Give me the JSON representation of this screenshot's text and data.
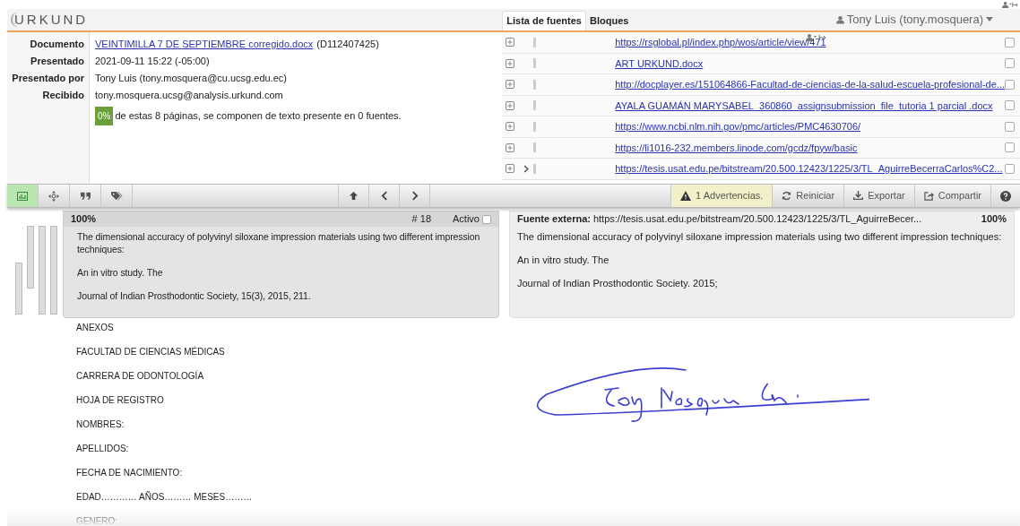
{
  "logo": "URKUND",
  "document_info": [
    {
      "label": "Documento",
      "link": "VEINTIMILLA 7 DE SEPTIEMBRE corregido.docx",
      "note": "(D112407425)"
    },
    {
      "label": "Presentado",
      "value": "2021-09-11 15:22 (-05:00)"
    },
    {
      "label": "Presentado por",
      "value": "Tony Luis (tony.mosquera@cu.ucsg.edu.ec)"
    },
    {
      "label": "Recibido",
      "value": "tony.mosquera.ucsg@analysis.urkund.com"
    }
  ],
  "similarity": {
    "percent": "0%",
    "text": "de estas 8 páginas, se componen de texto presente en 0 fuentes."
  },
  "tabs": [
    {
      "label": "Lista de fuentes",
      "selected": true
    },
    {
      "label": "Bloques",
      "selected": false
    }
  ],
  "user_menu": {
    "label": "Tony Luis (tony.mosquera)"
  },
  "sources": [
    {
      "link": "https://rsglobal.pl/index.php/wos/article/view/471",
      "current": false,
      "checked": false
    },
    {
      "link": "ART URKUND.docx",
      "current": false,
      "checked": false
    },
    {
      "link": "http://docplayer.es/151064866-Facultad-de-ciencias-de-la-salud-escuela-profesional-de...",
      "current": false,
      "checked": false
    },
    {
      "link": "AYALA GUAMÁN MARYSABEL_360860_assignsubmission_file_tutoria 1 parcial .docx",
      "current": false,
      "checked": false
    },
    {
      "link": "https://www.ncbi.nlm.nih.gov/pmc/articles/PMC4630706/",
      "current": false,
      "checked": false
    },
    {
      "link": "https://li1016-232.members.linode.com/gcdz/fpyw/basic",
      "current": false,
      "checked": false
    },
    {
      "link": "https://tesis.usat.edu.pe/bitstream/20.500.12423/1225/3/TL_AguirreBecerraCarlos%C2...",
      "current": true,
      "checked": false
    }
  ],
  "toolbar": {
    "left_buttons": [
      {
        "kind": "chart",
        "selected": true
      },
      {
        "kind": "move",
        "selected": false
      },
      {
        "kind": "quote",
        "selected": false
      },
      {
        "kind": "tags",
        "selected": false
      }
    ],
    "nav_buttons": [
      {
        "kind": "up"
      },
      {
        "kind": "prev"
      },
      {
        "kind": "next"
      }
    ],
    "right_buttons": [
      {
        "kind": "warning",
        "label": "1 Advertencias.",
        "highlighted": true
      },
      {
        "kind": "reset",
        "label": "Reiniciar",
        "highlighted": false
      },
      {
        "kind": "export",
        "label": "Exportar",
        "highlighted": false
      },
      {
        "kind": "share",
        "label": "Compartir",
        "highlighted": false
      },
      {
        "kind": "help",
        "highlighted": false
      }
    ]
  },
  "match": {
    "document_side": {
      "percent": "100%",
      "number": "# 18",
      "active_label": "Activo",
      "active_checked": false,
      "paragraphs": [
        "The dimensional accuracy of polyvinyl siloxane impression materials using two different impression techniques:",
        "An in vitro study. The",
        "Journal of Indian Prosthodontic Society, 15(3), 2015, 211."
      ]
    },
    "source_side": {
      "label": "Fuente externa:",
      "url": "https://tesis.usat.edu.pe/bitstream/20.500.12423/1225/3/TL_AguirreBecer...",
      "percent": "100%",
      "paragraphs": [
        "The dimensional accuracy of polyvinyl siloxane impression materials using two different impression techniques:",
        "An in vitro study. The",
        "Journal of Indian Prosthodontic Society. 2015;"
      ]
    }
  },
  "document_lines": [
    "ANEXOS",
    "FACULTAD DE CIENCIAS MÉDICAS",
    "CARRERA DE ODONTOLOGÍA",
    "HOJA DE REGISTRO",
    "NOMBRES:",
    "APELLIDOS:",
    "FECHA DE NACIMIENTO:",
    "EDAD………… AÑOS……… MESES………",
    "GENERO:"
  ]
}
